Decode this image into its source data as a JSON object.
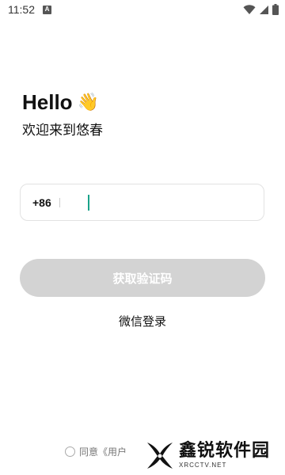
{
  "status_bar": {
    "time": "11:52",
    "notification_icon": "a-notification-icon",
    "wifi_icon": "wifi-icon",
    "signal_icon": "cell-signal-icon",
    "battery_icon": "battery-icon"
  },
  "greeting": {
    "hello": "Hello",
    "wave": "👋",
    "welcome": "欢迎来到悠春"
  },
  "phone": {
    "country_code": "+86",
    "value": "",
    "placeholder": ""
  },
  "actions": {
    "get_code": "获取验证码",
    "wechat_login": "微信登录"
  },
  "agreement": {
    "text": "同意《用户"
  },
  "watermark": {
    "title": "鑫锐软件园",
    "subtitle": "XRCCTV.NET"
  },
  "colors": {
    "caret": "#1aa38a",
    "button_disabled": "#d3d3d3"
  }
}
